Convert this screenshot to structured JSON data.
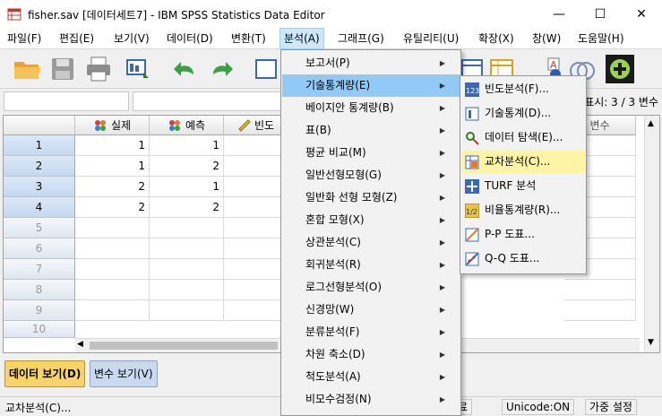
{
  "window": {
    "title": "fisher.sav [데이터세트7] - IBM SPSS Statistics Data Editor",
    "min_glyph": "—",
    "max_glyph": "☐",
    "close_glyph": "✕"
  },
  "menubar": [
    {
      "label": "파일(F)"
    },
    {
      "label": "편집(E)"
    },
    {
      "label": "보기(V)"
    },
    {
      "label": "데이터(D)"
    },
    {
      "label": "변환(T)"
    },
    {
      "label": "분석(A)",
      "active": true
    },
    {
      "label": "그래프(G)"
    },
    {
      "label": "유틸리티(U)"
    },
    {
      "label": "확장(X)"
    },
    {
      "label": "창(W)"
    },
    {
      "label": "도움말(H)"
    }
  ],
  "varcount": "표시: 3 / 3 변수",
  "grid": {
    "columns": [
      "실제",
      "예측",
      "빈도",
      "변수"
    ],
    "rows": [
      {
        "num": "1",
        "v1": "1",
        "v2": "1"
      },
      {
        "num": "2",
        "v1": "1",
        "v2": "2"
      },
      {
        "num": "3",
        "v1": "2",
        "v2": "1"
      },
      {
        "num": "4",
        "v1": "2",
        "v2": "2"
      },
      {
        "num": "5"
      },
      {
        "num": "6"
      },
      {
        "num": "7"
      },
      {
        "num": "8"
      },
      {
        "num": "9"
      },
      {
        "num": "10"
      }
    ]
  },
  "tabs": {
    "data_view": "데이터 보기(D)",
    "variable_view": "변수 보기(V)"
  },
  "statusbar": {
    "message": "교차분석(C)...",
    "partial": "료",
    "unicode": "Unicode:ON",
    "weight": "가중 설정"
  },
  "analyze_menu": [
    "보고서(P)",
    "기술통계량(E)",
    "베이지안 통계량(B)",
    "표(B)",
    "평균 비교(M)",
    "일반선형모형(G)",
    "일반화 선형 모형(Z)",
    "혼합 모형(X)",
    "상관분석(C)",
    "회귀분석(R)",
    "로그선형분석(O)",
    "신경망(W)",
    "분류분석(F)",
    "차원 축소(D)",
    "척도분석(A)",
    "비모수검정(N)"
  ],
  "descriptives_menu": [
    {
      "label": "빈도분석(F)...",
      "icon": "frequencies-icon"
    },
    {
      "label": "기술통계(D)...",
      "icon": "descriptives-icon"
    },
    {
      "label": "데이터 탐색(E)...",
      "icon": "explore-icon"
    },
    {
      "label": "교차분석(C)...",
      "icon": "crosstabs-icon"
    },
    {
      "label": "TURF 분석",
      "icon": "turf-icon"
    },
    {
      "label": "비율통계량(R)...",
      "icon": "ratio-icon"
    },
    {
      "label": "P-P 도표...",
      "icon": "pp-plot-icon"
    },
    {
      "label": "Q-Q 도표...",
      "icon": "qq-plot-icon"
    }
  ],
  "colors": {
    "accent": "#91c9f7",
    "highlight": "#fff3a6",
    "data_tab": "#f7d36a",
    "variable_tab": "#c9daf0"
  }
}
